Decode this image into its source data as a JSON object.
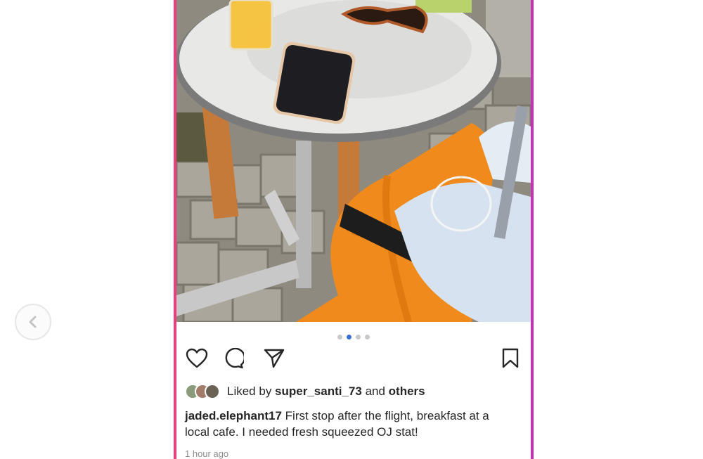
{
  "nav": {
    "prev_icon": "chevron-left-icon"
  },
  "post": {
    "image_description_icon": "photo",
    "carousel": {
      "count": 4,
      "active_index": 1
    },
    "actions": {
      "like_icon": "heart-icon",
      "comment_icon": "comment-icon",
      "share_icon": "paper-plane-icon",
      "save_icon": "bookmark-icon"
    },
    "likes": {
      "prefix": "Liked by ",
      "user": "super_santi_73",
      "joiner": " and ",
      "others": "others",
      "avatar_colors": [
        "#8a9a7b",
        "#a37d6a",
        "#6b6255"
      ]
    },
    "caption": {
      "username": "jaded.elephant17",
      "text": " First stop after the flight, breakfast at a local cafe. I needed fresh squeezed OJ stat!"
    },
    "timestamp": "1 hour ago"
  },
  "colors": {
    "frame_left": "#ee3d7e",
    "frame_right": "#c531b8",
    "active_dot": "#3a6fd8",
    "suitcase": "#f08a1c"
  }
}
